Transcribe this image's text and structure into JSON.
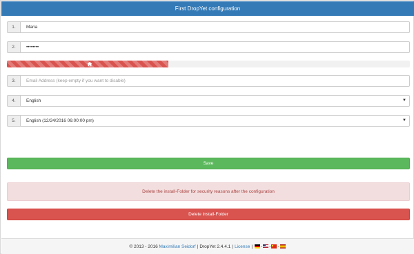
{
  "header": {
    "title": "First DropYet configuration"
  },
  "form": {
    "username": {
      "num": "1.",
      "value": "Maria"
    },
    "password": {
      "num": "2.",
      "value": "••••••••"
    },
    "password_strength": {
      "fraction": 0.4
    },
    "email": {
      "num": "3.",
      "placeholder": "Email Address (keep empty if you want to disable)"
    },
    "language": {
      "num": "4.",
      "value": "English"
    },
    "dateformat": {
      "num": "5.",
      "value": "English (12/24/2016 06:00:00 pm)"
    }
  },
  "buttons": {
    "save_label": "Save",
    "delete_label": "Delete install-Folder"
  },
  "alert": {
    "text": "Delete the install-Folder for security reasons after the configuration"
  },
  "footer": {
    "copyright": "© 2013 - 2016",
    "author": "Maximilian Seidorf",
    "app_version": "DropYet 2.4.4.1",
    "license": "License",
    "flags": [
      "de-flag-icon",
      "us-flag-icon",
      "cn-flag-icon",
      "es-flag-icon"
    ]
  },
  "colors": {
    "header": "#337ab7",
    "save": "#5cb85c",
    "delete": "#d9534f",
    "alert_bg": "#f2dede",
    "alert_text": "#a94442"
  }
}
